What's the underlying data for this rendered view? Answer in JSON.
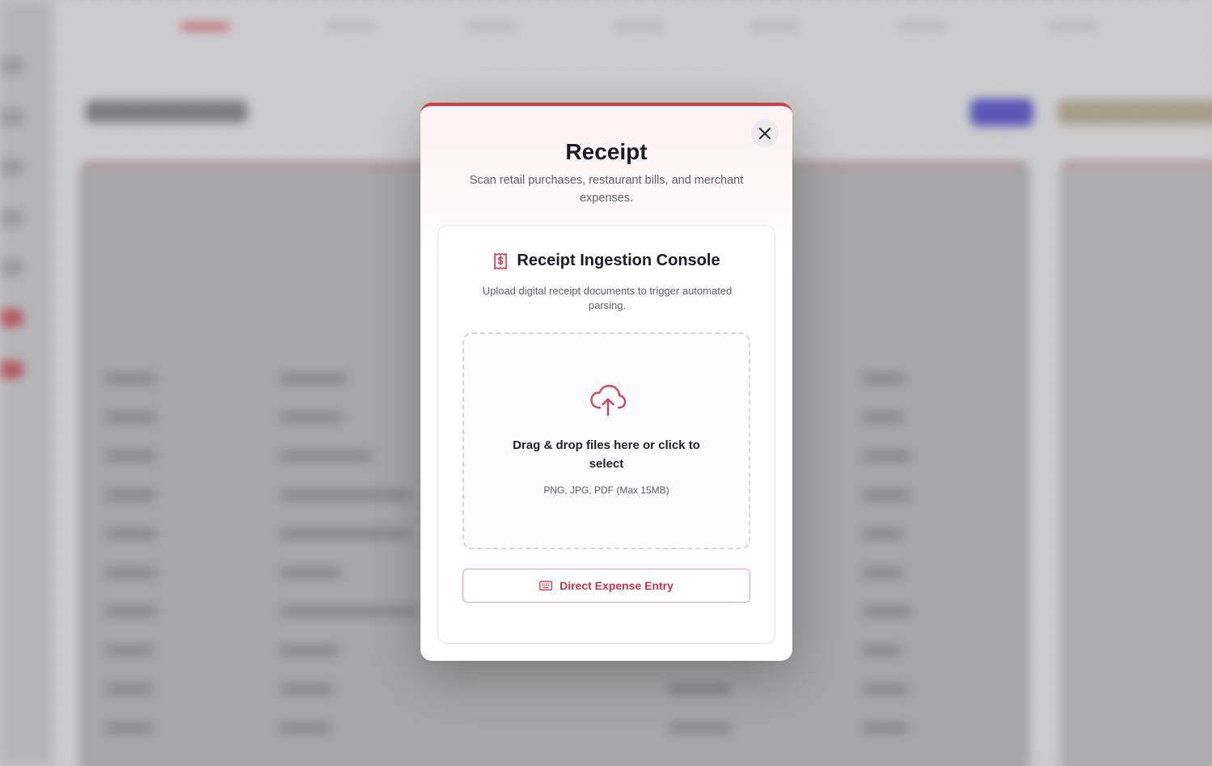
{
  "modal": {
    "title": "Receipt",
    "subtitle": "Scan retail purchases, restaurant bills, and merchant expenses.",
    "close_icon": "close-icon"
  },
  "console": {
    "icon": "receipt-dollar-icon",
    "title": "Receipt Ingestion Console",
    "description": "Upload digital receipt documents to trigger automated parsing."
  },
  "dropzone": {
    "icon": "cloud-upload-icon",
    "label": "Drag & drop files here or click to select",
    "formats": "PNG, JPG, PDF (Max 15MB)"
  },
  "manual_entry": {
    "icon": "keyboard-icon",
    "label": "Direct Expense Entry"
  },
  "colors": {
    "accent": "#d03a4b",
    "accent_text": "#c83447",
    "title_text": "#1a1b26",
    "muted_text": "#5b5d6b"
  }
}
